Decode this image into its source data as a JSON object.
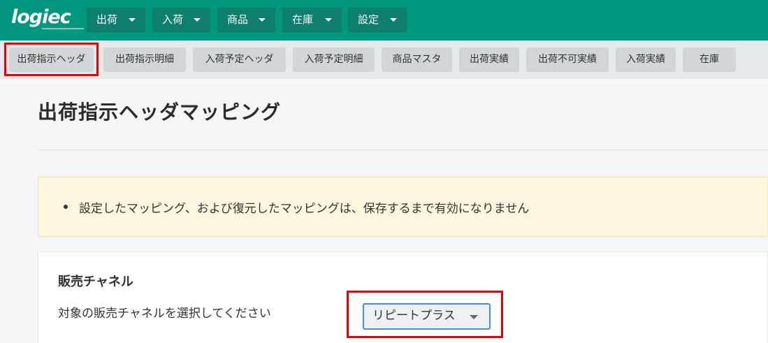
{
  "brand": {
    "logo": "logiec"
  },
  "top_menu": [
    {
      "label": "出荷"
    },
    {
      "label": "入荷"
    },
    {
      "label": "商品"
    },
    {
      "label": "在庫"
    },
    {
      "label": "設定"
    }
  ],
  "sub_tabs": [
    {
      "label": "出荷指示ヘッダ"
    },
    {
      "label": "出荷指示明細"
    },
    {
      "label": "入荷予定ヘッダ"
    },
    {
      "label": "入荷予定明細"
    },
    {
      "label": "商品マスタ"
    },
    {
      "label": "出荷実績"
    },
    {
      "label": "出荷不可実績"
    },
    {
      "label": "入荷実績"
    },
    {
      "label": "在庫"
    }
  ],
  "page": {
    "title": "出荷指示ヘッダマッピング"
  },
  "notice": {
    "message": "設定したマッピング、および復元したマッピングは、保存するまで有効になりません"
  },
  "sales_channel": {
    "title": "販売チャネル",
    "description": "対象の販売チャネルを選択してください",
    "selected": "リピートプラス"
  },
  "colors": {
    "header": "#00977f",
    "menu_button": "#0d7f6c",
    "highlight": "#e60000",
    "select_border": "#4a8fd6"
  }
}
